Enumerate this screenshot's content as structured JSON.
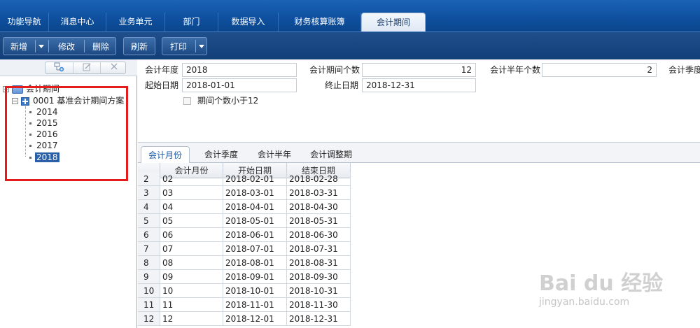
{
  "top_nav": {
    "tabs": [
      {
        "label": "功能导航"
      },
      {
        "label": "消息中心"
      },
      {
        "label": "业务单元"
      },
      {
        "label": "部门"
      },
      {
        "label": "数据导入"
      },
      {
        "label": "财务核算账簿"
      },
      {
        "label": "会计期间",
        "active": true
      }
    ]
  },
  "toolbar": {
    "new_label": "新增",
    "edit_label": "修改",
    "delete_label": "删除",
    "refresh_label": "刷新",
    "print_label": "打印"
  },
  "tree": {
    "root_label": "会计期间",
    "scheme_label": "0001 基准会计期间方案",
    "years": [
      "2014",
      "2015",
      "2016",
      "2017",
      "2018"
    ],
    "selected_year": "2018"
  },
  "form": {
    "fiscal_year_label": "会计年度",
    "fiscal_year_value": "2018",
    "period_count_label": "会计期间个数",
    "period_count_value": "12",
    "half_year_count_label": "会计半年个数",
    "half_year_count_value": "2",
    "quarter_label": "会计季度",
    "start_date_label": "起始日期",
    "start_date_value": "2018-01-01",
    "end_date_label": "终止日期",
    "end_date_value": "2018-12-31",
    "checkbox_label": "期间个数小于12"
  },
  "tabs": [
    {
      "label": "会计月份",
      "active": true
    },
    {
      "label": "会计季度"
    },
    {
      "label": "会计半年"
    },
    {
      "label": "会计调整期"
    }
  ],
  "table": {
    "columns": [
      "会计月份",
      "开始日期",
      "结束日期"
    ],
    "rows": [
      {
        "n": "2",
        "month": "02",
        "start": "2018-02-01",
        "end": "2018-02-28"
      },
      {
        "n": "3",
        "month": "03",
        "start": "2018-03-01",
        "end": "2018-03-31"
      },
      {
        "n": "4",
        "month": "04",
        "start": "2018-04-01",
        "end": "2018-04-30"
      },
      {
        "n": "5",
        "month": "05",
        "start": "2018-05-01",
        "end": "2018-05-31"
      },
      {
        "n": "6",
        "month": "06",
        "start": "2018-06-01",
        "end": "2018-06-30"
      },
      {
        "n": "7",
        "month": "07",
        "start": "2018-07-01",
        "end": "2018-07-31"
      },
      {
        "n": "8",
        "month": "08",
        "start": "2018-08-01",
        "end": "2018-08-31"
      },
      {
        "n": "9",
        "month": "09",
        "start": "2018-09-01",
        "end": "2018-09-30"
      },
      {
        "n": "10",
        "month": "10",
        "start": "2018-10-01",
        "end": "2018-10-31"
      },
      {
        "n": "11",
        "month": "11",
        "start": "2018-11-01",
        "end": "2018-11-30"
      },
      {
        "n": "12",
        "month": "12",
        "start": "2018-12-01",
        "end": "2018-12-31"
      }
    ]
  },
  "watermark": {
    "brand": "Bai du 经验",
    "url": "jingyan.baidu.com"
  },
  "colors": {
    "nav_bg": "#0e4f9e",
    "selection": "#2b5fa6",
    "highlight_box": "#e51c1c"
  }
}
